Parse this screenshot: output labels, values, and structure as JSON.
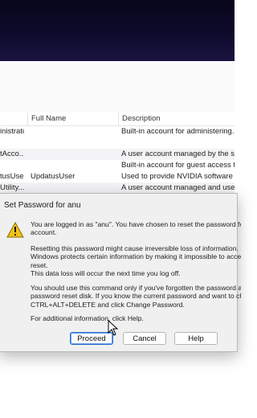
{
  "table": {
    "columns": [
      "Full Name",
      "Description"
    ],
    "rows": [
      {
        "name": "inistrator",
        "full_name": "",
        "description": "Built-in account for administering..."
      },
      {
        "name": "",
        "full_name": "",
        "description": ""
      },
      {
        "name": "tAcco...",
        "full_name": "",
        "description": "A user account managed by the s..."
      },
      {
        "name": "",
        "full_name": "",
        "description": "Built-in account for guest access t..."
      },
      {
        "name": "tusUser",
        "full_name": "UpdatusUser",
        "description": "Used to provide NVIDIA software ..."
      },
      {
        "name": "Utility...",
        "full_name": "",
        "description": "A user account managed and use..."
      }
    ]
  },
  "dialog": {
    "title": "Set Password for anu",
    "icon": "warning-icon",
    "message_1": "You are logged in as \"anu\". You have chosen to reset the password for t\naccount.",
    "message_2": "Resetting this password might cause irreversible loss of information. For s\nWindows protects certain information by making it impossible to access i\nreset.",
    "message_3": "This data loss will occur the next time you log off.",
    "message_4": "You should use this command only if you've forgotten the password and\npassword reset disk. If you know the current password and want to cha\nCTRL+ALT+DELETE and click Change Password.",
    "message_5": "For additional information, click Help.",
    "proceed_label": "Proceed",
    "cancel_label": "Cancel",
    "help_label": "Help"
  }
}
